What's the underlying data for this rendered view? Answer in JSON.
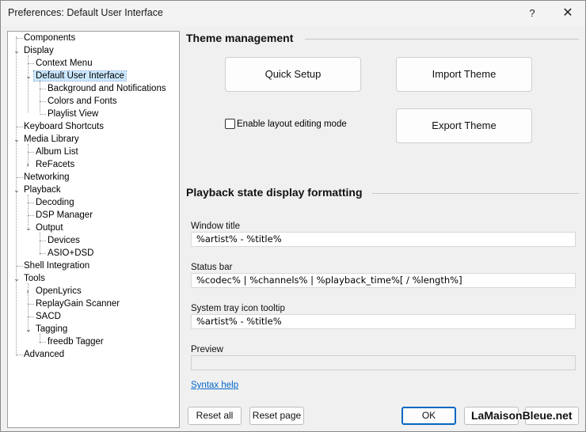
{
  "window": {
    "title": "Preferences: Default User Interface",
    "help": "?",
    "close": "✕"
  },
  "tree": {
    "items": [
      {
        "label": "Components"
      },
      {
        "label": "Display"
      },
      {
        "label": "Context Menu"
      },
      {
        "label": "Default User Interface"
      },
      {
        "label": "Background and Notifications"
      },
      {
        "label": "Colors and Fonts"
      },
      {
        "label": "Playlist View"
      },
      {
        "label": "Keyboard Shortcuts"
      },
      {
        "label": "Media Library"
      },
      {
        "label": "Album List"
      },
      {
        "label": "ReFacets"
      },
      {
        "label": "Networking"
      },
      {
        "label": "Playback"
      },
      {
        "label": "Decoding"
      },
      {
        "label": "DSP Manager"
      },
      {
        "label": "Output"
      },
      {
        "label": "Devices"
      },
      {
        "label": "ASIO+DSD"
      },
      {
        "label": "Shell Integration"
      },
      {
        "label": "Tools"
      },
      {
        "label": "OpenLyrics"
      },
      {
        "label": "ReplayGain Scanner"
      },
      {
        "label": "SACD"
      },
      {
        "label": "Tagging"
      },
      {
        "label": "freedb Tagger"
      },
      {
        "label": "Advanced"
      }
    ]
  },
  "theme": {
    "title": "Theme management",
    "quick_setup": "Quick Setup",
    "import_theme": "Import Theme",
    "export_theme": "Export Theme",
    "layout_editing_label": "Enable layout editing mode"
  },
  "playback": {
    "title": "Playback state display formatting",
    "window_title_label": "Window title",
    "window_title_value": "%artist% - %title%",
    "status_bar_label": "Status bar",
    "status_bar_value": "%codec% | %channels% | %playback_time%[ / %length%]",
    "tray_label": "System tray icon tooltip",
    "tray_value": "%artist% - %title%",
    "preview_label": "Preview",
    "preview_value": "",
    "syntax_help": "Syntax help"
  },
  "footer": {
    "reset_all": "Reset all",
    "reset_page": "Reset page",
    "ok": "OK",
    "watermark": "LaMaisonBleue.net"
  }
}
